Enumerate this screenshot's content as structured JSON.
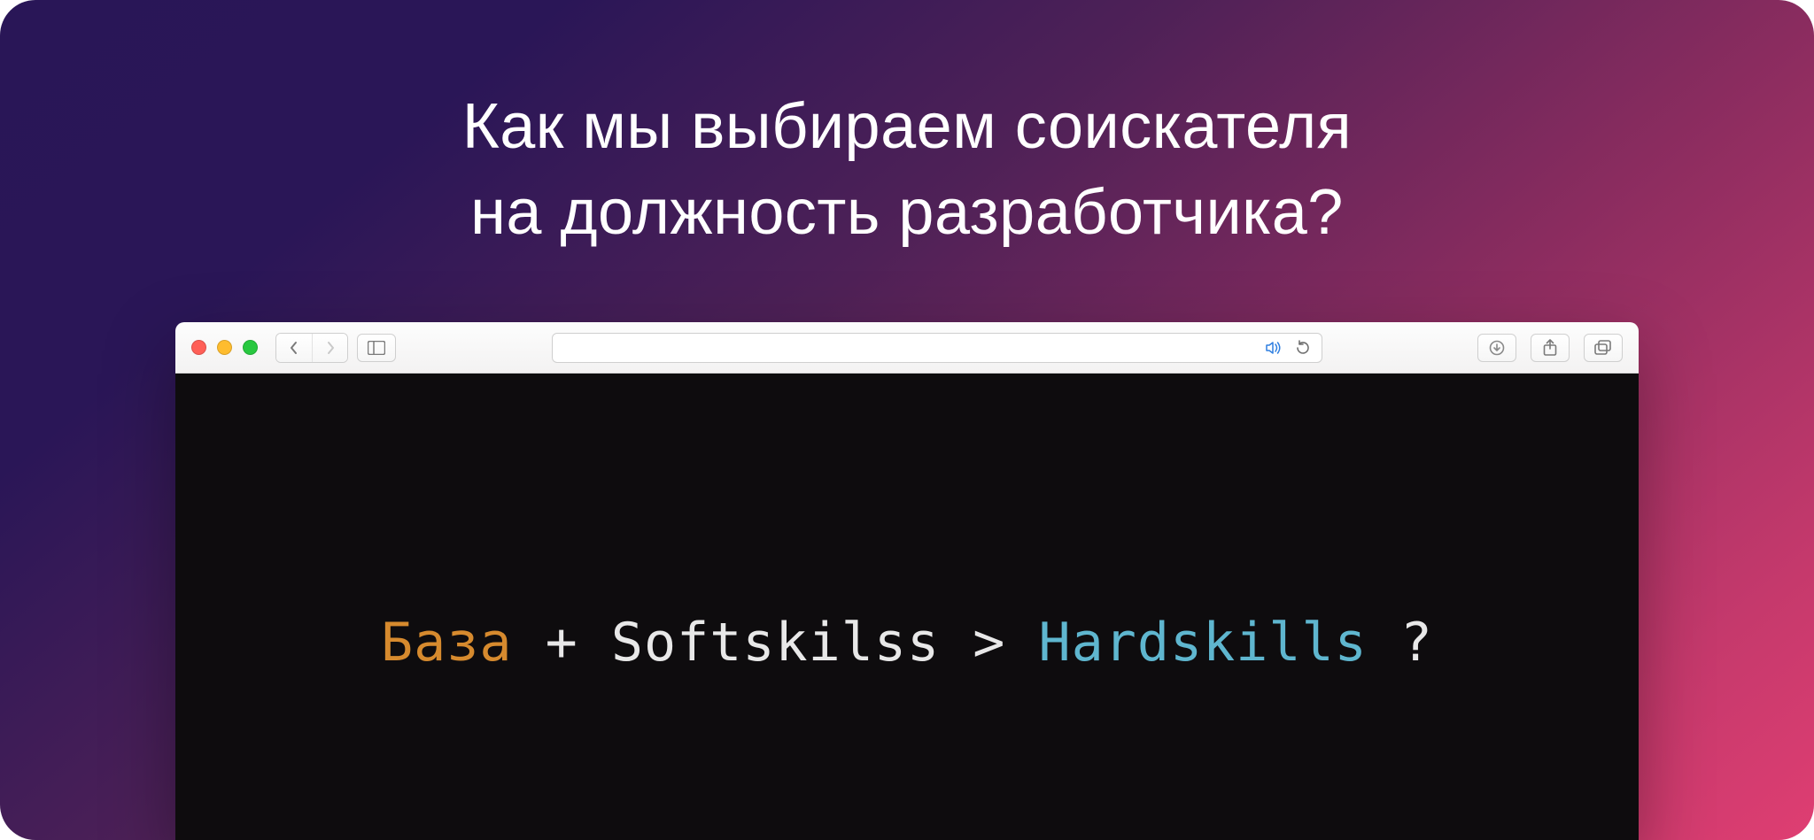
{
  "heading": {
    "line1": "Как мы выбираем соискателя",
    "line2": "на должность разработчика?"
  },
  "browser": {
    "traffic": {
      "close": "close",
      "minimize": "minimize",
      "zoom": "zoom"
    },
    "nav": {
      "back": "back",
      "forward": "forward",
      "sidebar": "sidebar"
    },
    "address_value": "",
    "addr_icons": {
      "audio": "audio-icon",
      "reload": "reload"
    },
    "right": {
      "downloads": "downloads",
      "share": "share",
      "tabs": "tabs"
    }
  },
  "code": {
    "t1": "База",
    "t2": " + ",
    "t3": "Softskilss",
    "t4": " > ",
    "t5": "Hardskills",
    "t6": " ?"
  },
  "colors": {
    "orange": "#d68a2e",
    "white": "#e8e8e8",
    "cyan": "#5fb6cf",
    "terminal_bg": "#0e0c0e"
  }
}
